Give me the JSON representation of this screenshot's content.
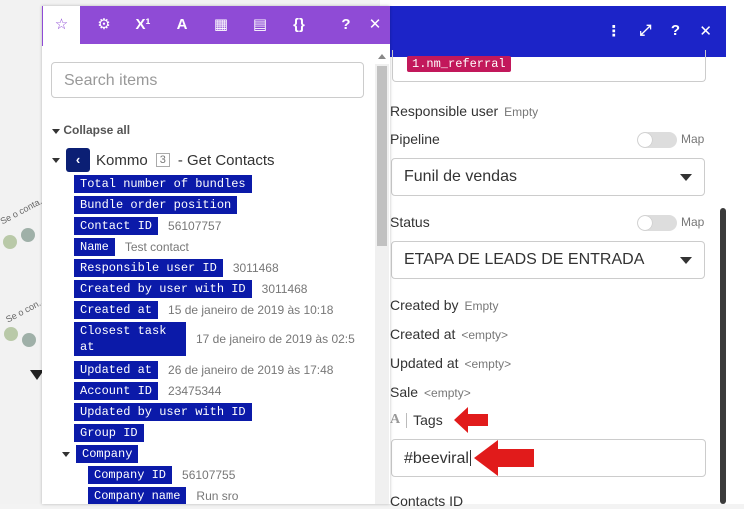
{
  "canvas": {
    "labels": [
      "Se o conta...",
      "Se o con..."
    ]
  },
  "colors": {
    "mapping_tab_bar": "#8f4bd6",
    "module_header": "#1c24c8",
    "item_pill": "#0b1aa9",
    "referral_pill": "#c2185b",
    "annotation_arrow": "#e11b1b"
  },
  "mapping_panel": {
    "tabs": [
      {
        "icon": "star-icon",
        "glyph": "☆"
      },
      {
        "icon": "gear-icon",
        "glyph": "⚙"
      },
      {
        "icon": "superscript-icon",
        "glyph": "X¹"
      },
      {
        "icon": "text-format-icon",
        "glyph": "A"
      },
      {
        "icon": "calendar-icon",
        "glyph": "▦"
      },
      {
        "icon": "table-icon",
        "glyph": "▤"
      },
      {
        "icon": "braces-icon",
        "glyph": "{}"
      }
    ],
    "help_glyph": "?",
    "close_glyph": "✕",
    "search_placeholder": "Search items",
    "collapse_all": "Collapse all",
    "module": {
      "name": "Kommo",
      "count": "3",
      "action": "- Get Contacts"
    },
    "items": [
      {
        "label": "Total number of bundles",
        "value": ""
      },
      {
        "label": "Bundle order position",
        "value": ""
      },
      {
        "label": "Contact ID",
        "value": "56107757"
      },
      {
        "label": "Name",
        "value": "Test contact"
      },
      {
        "label": "Responsible user ID",
        "value": "3011468"
      },
      {
        "label": "Created by user with ID",
        "value": "3011468"
      },
      {
        "label": "Created at",
        "value": "15 de janeiro de 2019 às 10:18"
      },
      {
        "label": "Closest task at",
        "value": "17 de janeiro de 2019 às 02:5"
      },
      {
        "label": "Updated at",
        "value": "26 de janeiro de 2019 às 17:48"
      },
      {
        "label": "Account ID",
        "value": "23475344"
      },
      {
        "label": "Updated by user with ID",
        "value": ""
      },
      {
        "label": "Group ID",
        "value": ""
      },
      {
        "label": "Company",
        "value": ""
      },
      {
        "label": "Company ID",
        "value": "56107755"
      },
      {
        "label": "Company name",
        "value": "Run sro"
      }
    ]
  },
  "module_panel": {
    "header_icons": [
      "⋮",
      "⤢",
      "?",
      "✕"
    ],
    "previous_field_pill": "1.nm_referral",
    "responsible_user": {
      "label": "Responsible user",
      "value": "Empty"
    },
    "pipeline": {
      "label": "Pipeline",
      "map_label": "Map",
      "value": "Funil de vendas"
    },
    "status": {
      "label": "Status",
      "map_label": "Map",
      "value": "ETAPA DE LEADS DE ENTRADA"
    },
    "created_by": {
      "label": "Created by",
      "value": "Empty"
    },
    "created_at": {
      "label": "Created at",
      "value": "<empty>"
    },
    "updated_at": {
      "label": "Updated at",
      "value": "<empty>"
    },
    "sale": {
      "label": "Sale",
      "value": "<empty>"
    },
    "tags": {
      "label": "Tags",
      "icon_glyph": "A",
      "value": "#beeviral"
    },
    "next_field_label": "Contacts ID"
  }
}
